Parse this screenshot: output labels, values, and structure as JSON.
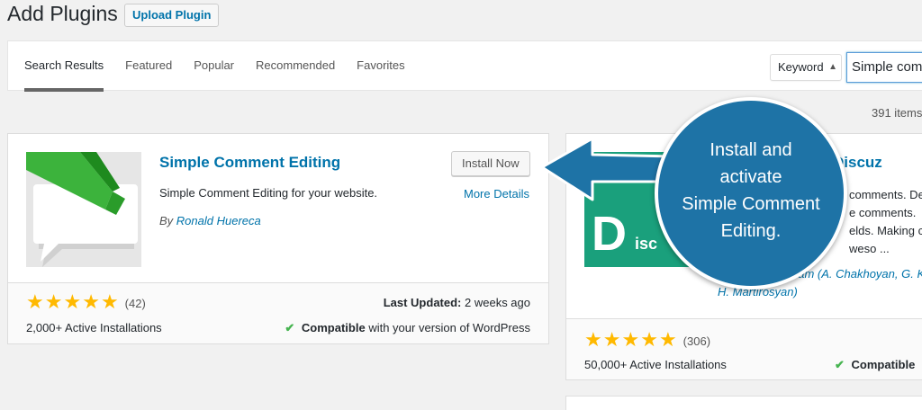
{
  "header": {
    "title": "Add Plugins",
    "upload_label": "Upload Plugin"
  },
  "filter": {
    "tabs": [
      {
        "label": "Search Results",
        "current": true
      },
      {
        "label": "Featured",
        "current": false
      },
      {
        "label": "Popular",
        "current": false
      },
      {
        "label": "Recommended",
        "current": false
      },
      {
        "label": "Favorites",
        "current": false
      }
    ],
    "search_type": "Keyword",
    "search_value": "Simple comment editing"
  },
  "results": {
    "count_text": "391 items"
  },
  "plugins": [
    {
      "name": "Simple Comment Editing",
      "install_label": "Install Now",
      "more_details_label": "More Details",
      "description": "Simple Comment Editing for your website.",
      "author_prefix": "By",
      "author": "Ronald Huereca",
      "stars": 5,
      "rating_count": "(42)",
      "installs": "2,000+ Active Installations",
      "last_updated_label": "Last Updated:",
      "last_updated_value": "2 weeks ago",
      "compat_bold": "Compatible",
      "compat_rest": "with your version of WordPress"
    },
    {
      "name": "Discuz",
      "icon_letter": "D",
      "icon_word": "isc",
      "description_lines": [
        "comments. De",
        "e comments.",
        "elds. Making co",
        "weso ..."
      ],
      "author_line1": "eam (A. Chakhoyan, G. K",
      "author_line2": "H. Martirosyan)",
      "stars": 5,
      "rating_count": "(306)",
      "installs": "50,000+ Active Installations",
      "compat_bold": "Compatible"
    }
  ],
  "callout": {
    "text_lines": [
      "Install and",
      "activate",
      "Simple Comment",
      "Editing."
    ],
    "color": "#1e73a6"
  },
  "colors": {
    "link": "#0073aa",
    "star": "#ffb900",
    "check": "#46b450",
    "discuz_bg": "#1aa07c"
  }
}
